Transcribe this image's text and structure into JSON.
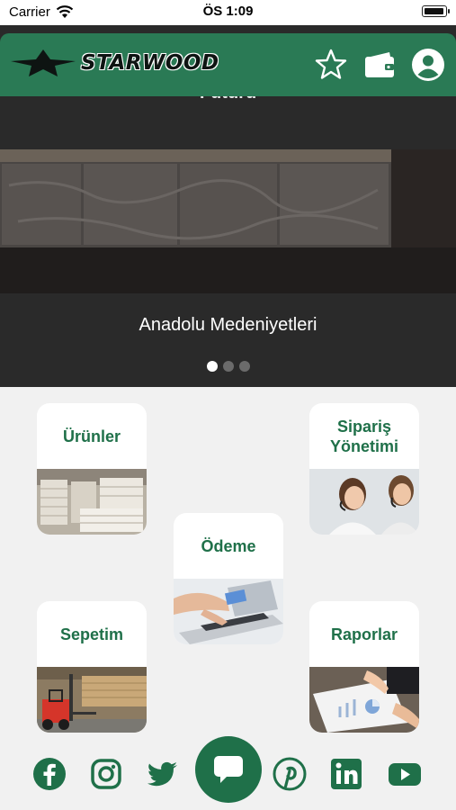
{
  "status_bar": {
    "carrier": "Carrier",
    "time": "ÖS 1:09",
    "battery_level": 1.0
  },
  "header": {
    "brand": "STARWOOD",
    "icons": [
      "star-icon",
      "wallet-icon",
      "account-icon"
    ]
  },
  "hero": {
    "hidden_title": "Futuru",
    "caption": "Anadolu Medeniyetleri",
    "slides_total": 3,
    "active_slide": 1
  },
  "menu": {
    "products": "Ürünler",
    "orders": "Sipariş Yönetimi",
    "payment": "Ödeme",
    "cart": "Sepetim",
    "reports": "Raporlar"
  },
  "social": [
    "facebook-icon",
    "instagram-icon",
    "twitter-icon",
    "chat-icon",
    "pinterest-icon",
    "linkedin-icon",
    "youtube-icon"
  ],
  "colors": {
    "brand_green": "#2a7a55",
    "dark_green": "#1f7049",
    "background": "#f1f1f1"
  }
}
